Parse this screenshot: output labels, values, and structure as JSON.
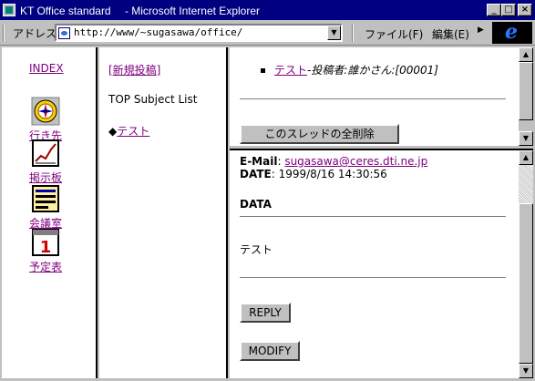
{
  "window": {
    "title": "KT Office standard　 - Microsoft Internet Explorer",
    "minimize": "_",
    "maximize": "□",
    "close": "×"
  },
  "addressbar": {
    "label": "アドレス",
    "url": "http://www/~sugasawa/office/",
    "menu_file": "ファイル(F)",
    "menu_edit": "編集(E)",
    "more": "▶",
    "logo": "e"
  },
  "left_nav": {
    "index_label": "INDEX",
    "items": [
      {
        "label": "行き先",
        "icon": "compass-icon"
      },
      {
        "label": "掲示板",
        "icon": "chart-board-icon"
      },
      {
        "label": "会議室",
        "icon": "document-list-icon"
      },
      {
        "label": "予定表",
        "icon": "calendar-icon"
      }
    ],
    "calendar_digit": "1"
  },
  "mid_frame": {
    "new_post": "[新規投稿]",
    "list_title": "TOP Subject List",
    "diamond": "◆",
    "topic_link": "テスト"
  },
  "thread_frame": {
    "bullet_link": "テスト",
    "bullet_meta": "-投稿者:誰かさん:[00001]",
    "delete_button": "このスレッドの全削除"
  },
  "message_frame": {
    "email_label": "E-Mail",
    "email": "sugasawa@ceres.dti.ne.jp",
    "date_label": "DATE",
    "date": "1999/8/16 14:30:56",
    "data_heading": "DATA",
    "body": "テスト",
    "reply_button": "REPLY",
    "modify_button": "MODIFY"
  }
}
